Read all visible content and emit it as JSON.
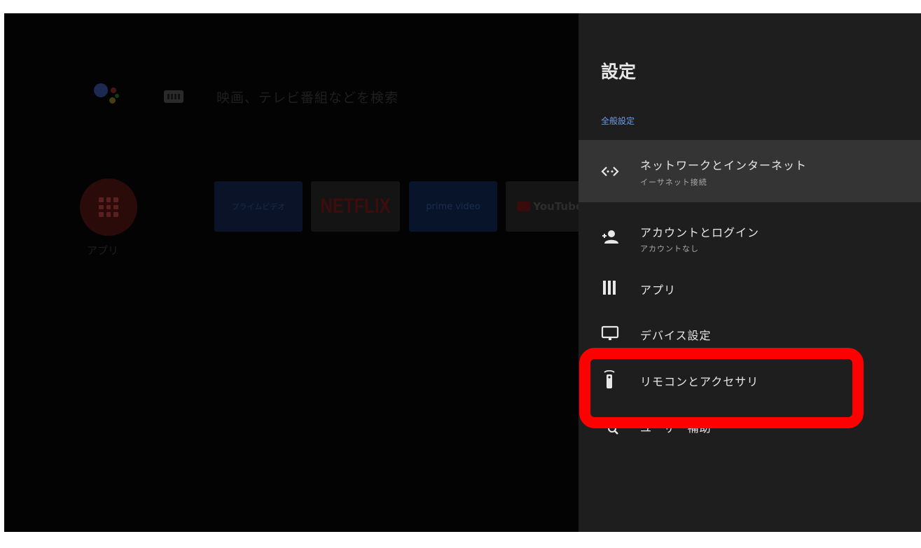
{
  "home": {
    "search_placeholder": "映画、テレビ番組などを検索",
    "apps_label": "アプリ",
    "tiles": [
      {
        "name": "prime-video-tile",
        "label": "プライムビデオ"
      },
      {
        "name": "netflix-tile",
        "label": "NETFLIX"
      },
      {
        "name": "amazon-prime-tile",
        "label": "prime video"
      },
      {
        "name": "youtube-tile",
        "label": "YouTube"
      }
    ]
  },
  "settings": {
    "title": "設定",
    "section_label": "全般設定",
    "items": [
      {
        "label": "ネットワークとインターネット",
        "sublabel": "イーサネット接続",
        "icon": "network-arrows-icon",
        "selected": true
      },
      {
        "label": "アカウントとログイン",
        "sublabel": "アカウントなし",
        "icon": "account-icon"
      },
      {
        "label": "アプリ",
        "icon": "apps-bars-icon"
      },
      {
        "label": "デバイス設定",
        "icon": "monitor-icon"
      },
      {
        "label": "リモコンとアクセサリ",
        "icon": "remote-icon"
      },
      {
        "label": "ユーザー補助",
        "icon": "accessibility-icon"
      }
    ]
  },
  "annotation": {
    "color": "#ff0000",
    "target": "remote-and-accessories-item"
  }
}
